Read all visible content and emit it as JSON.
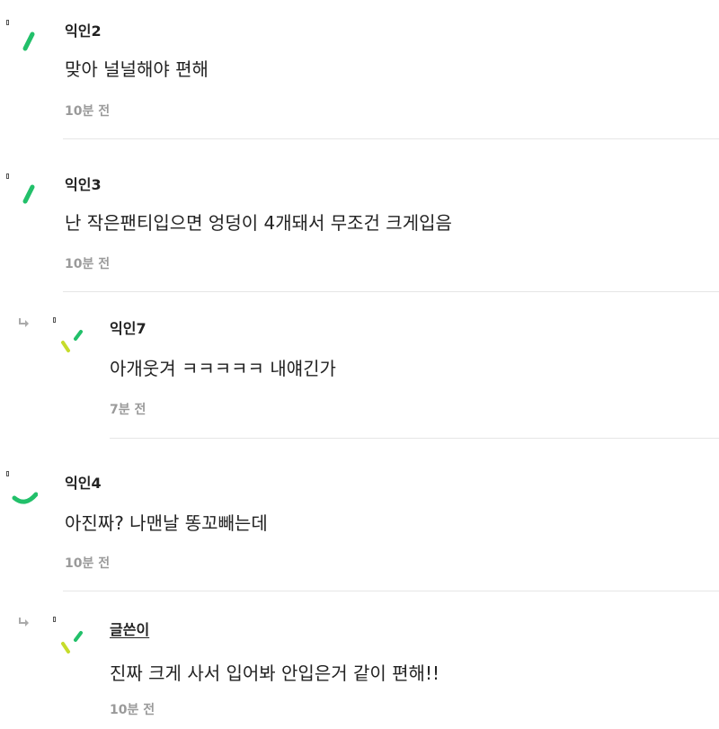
{
  "comments": [
    {
      "author": "익인2",
      "text": "맞아 널널해야 편해",
      "time": "10분 전",
      "avatar": "green-slash-icon"
    },
    {
      "author": "익인3",
      "text": "난 작은팬티입으면 엉덩이 4개돼서 무조건 크게입음",
      "time": "10분 전",
      "avatar": "green-slash-icon"
    },
    {
      "author": "익인7",
      "text": "아개웃겨 ㅋㅋㅋㅋㅋ 내얘긴가",
      "time": "7분 전",
      "avatar": "lime-double-slash-icon",
      "reply": true
    },
    {
      "author": "익인4",
      "text": "아진짜? 나맨날 똥꼬빼는데",
      "time": "10분 전",
      "avatar": "green-curve-icon"
    },
    {
      "author": "글쓴이",
      "text": "진짜 크게 사서 입어봐 안입은거 같이 편해!!",
      "time": "10분 전",
      "avatar": "lime-double-slash-icon",
      "reply": true
    }
  ],
  "colors": {
    "green": "#22c06a",
    "lime": "#c6dc2b",
    "muted": "#9a9a9a",
    "divider": "#e6e6e6"
  }
}
